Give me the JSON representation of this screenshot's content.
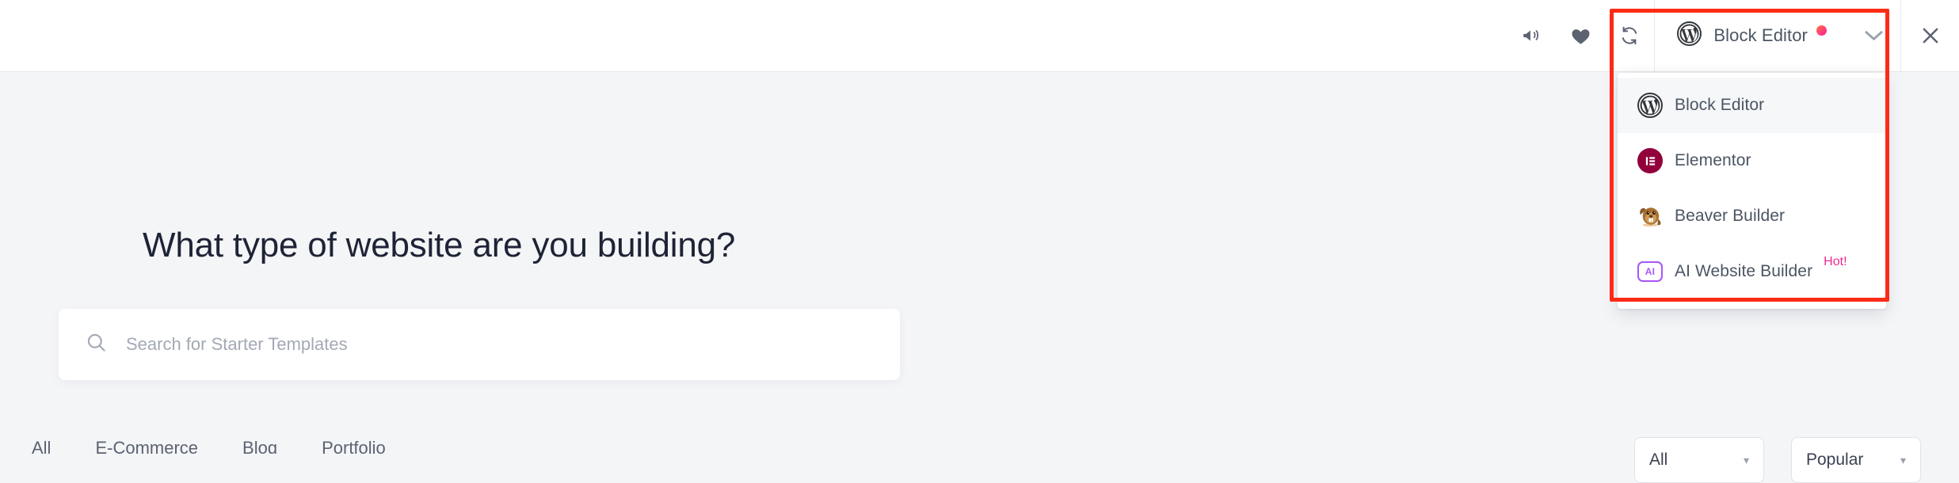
{
  "header": {
    "icons": [
      {
        "name": "announcement-icon",
        "label": "Announcements"
      },
      {
        "name": "heart-icon",
        "label": "Favorites"
      },
      {
        "name": "sync-icon",
        "label": "Sync Library"
      }
    ],
    "editor_selector": {
      "label": "Block Editor",
      "icon": "wordpress-icon",
      "has_notification_dot": true,
      "caret": "chevron-down-icon"
    },
    "close_label": "Close"
  },
  "editor_dropdown": {
    "items": [
      {
        "label": "Block Editor",
        "icon": "wordpress-icon",
        "selected": true,
        "badge": ""
      },
      {
        "label": "Elementor",
        "icon": "elementor-icon",
        "selected": false,
        "badge": ""
      },
      {
        "label": "Beaver Builder",
        "icon": "beaver-builder-icon",
        "selected": false,
        "badge": ""
      },
      {
        "label": "AI Website Builder",
        "icon": "ai-builder-icon",
        "selected": false,
        "badge": "Hot!"
      }
    ]
  },
  "main": {
    "heading": "What type of website are you building?",
    "search": {
      "placeholder": "Search for Starter Templates",
      "value": "",
      "icon": "search-icon"
    },
    "categories": [
      "All",
      "E-Commerce",
      "Blog",
      "Portfolio"
    ],
    "filters": [
      {
        "name": "type-filter",
        "value": "All"
      },
      {
        "name": "sort-filter",
        "value": "Popular"
      }
    ]
  },
  "annotation": {
    "color": "#fc2b16",
    "target": "editor-selector-and-dropdown"
  }
}
